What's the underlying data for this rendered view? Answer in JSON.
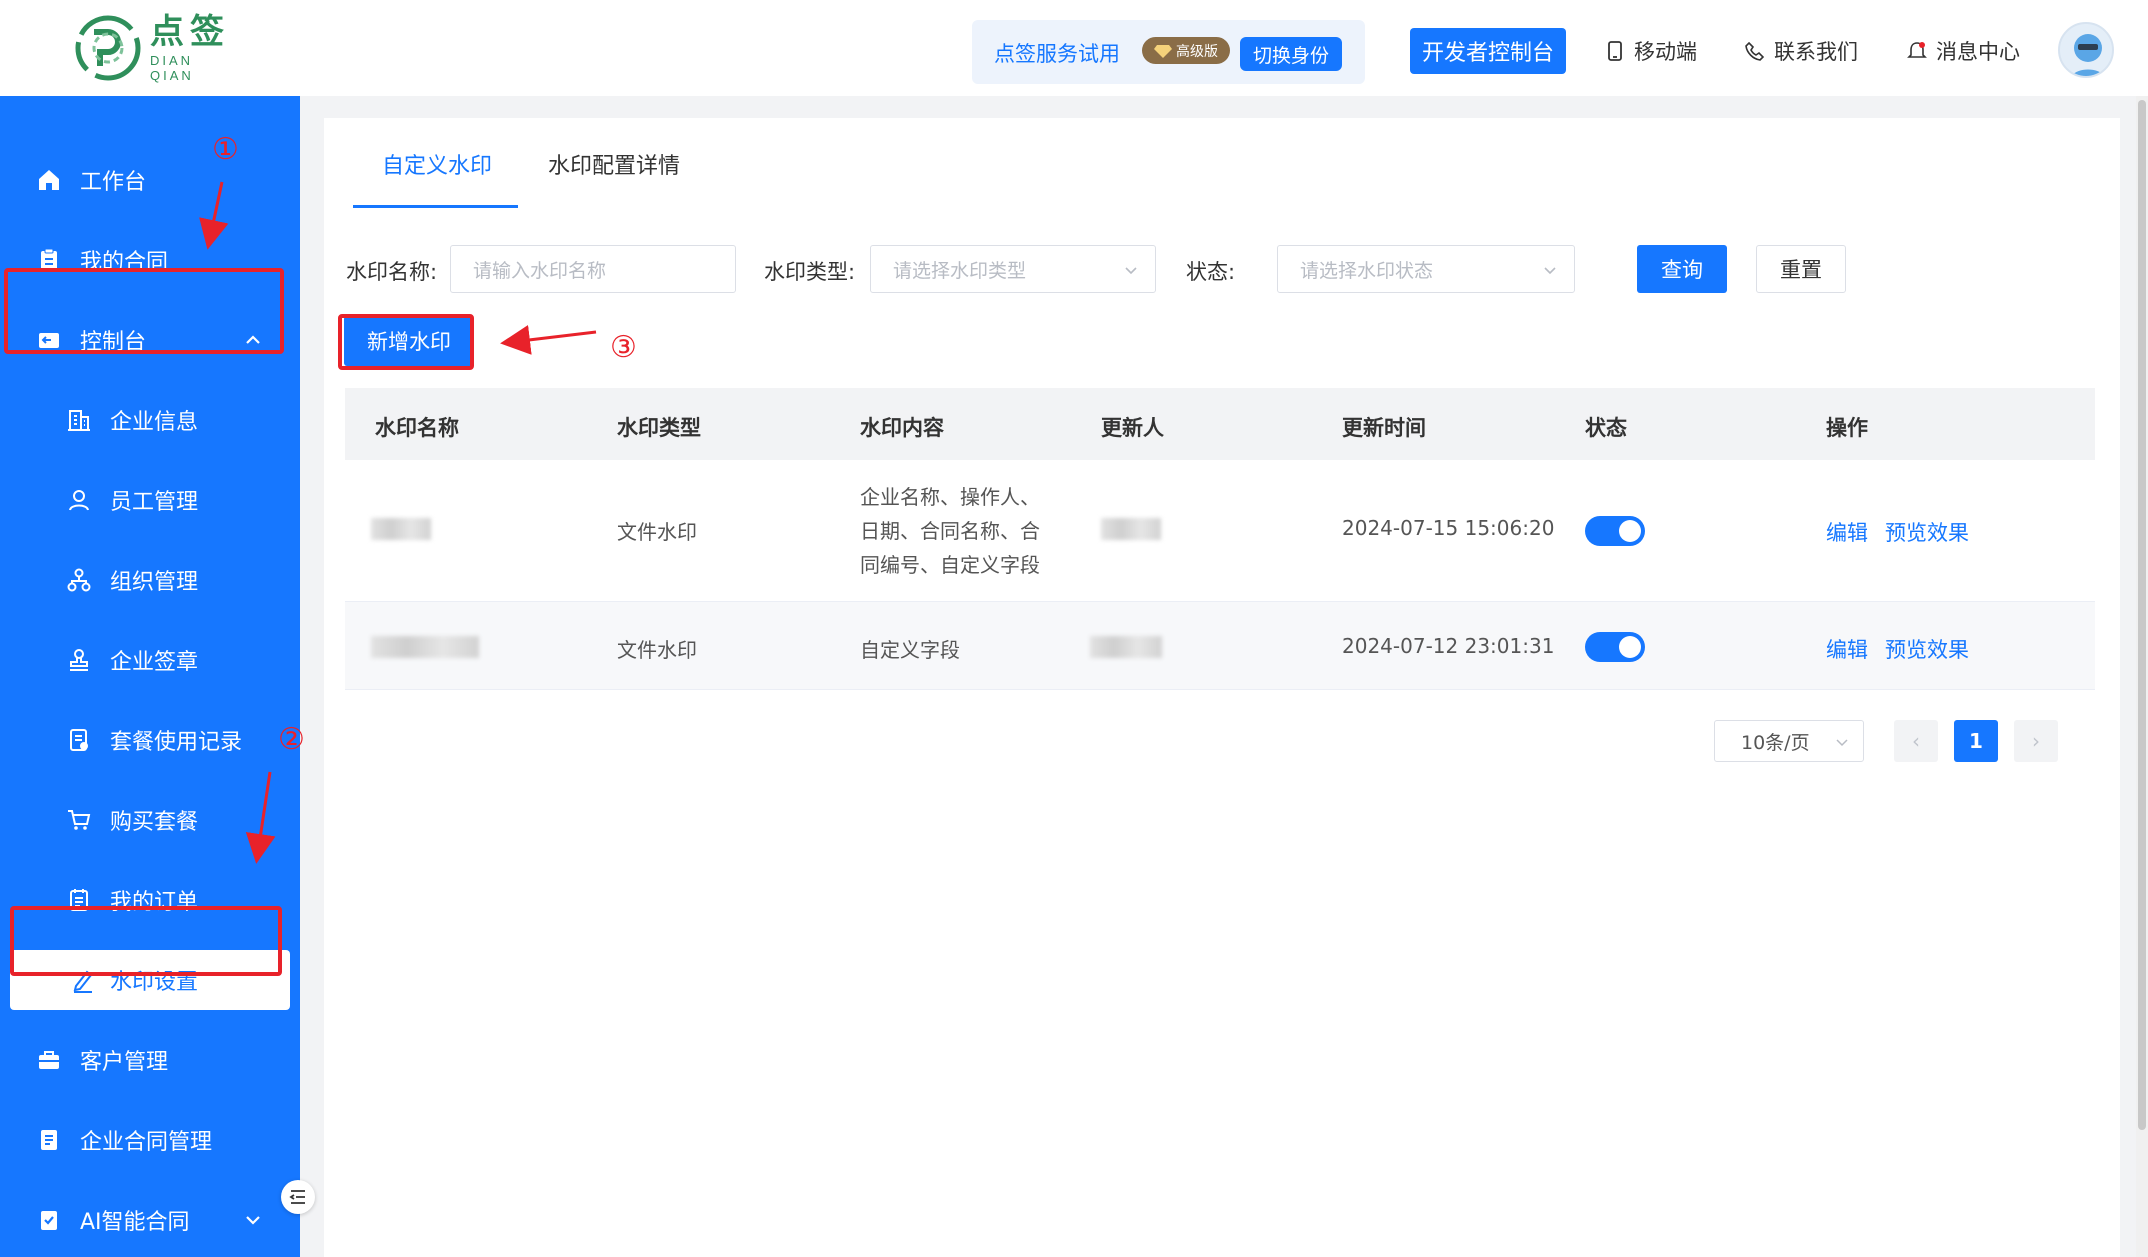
{
  "brand": {
    "name_cn": "点签",
    "name_en": "DIAN QIAN"
  },
  "header": {
    "trial_text": "点签服务试用",
    "badge": "高级版",
    "switch_identity": "切换身份",
    "dev_console": "开发者控制台",
    "mobile": "移动端",
    "contact": "联系我们",
    "messages": "消息中心"
  },
  "sidebar": {
    "items": [
      {
        "label": "工作台",
        "icon": "home-icon"
      },
      {
        "label": "我的合同",
        "icon": "clipboard-icon"
      },
      {
        "label": "控制台",
        "icon": "console-icon"
      },
      {
        "label": "企业信息",
        "icon": "building-icon"
      },
      {
        "label": "员工管理",
        "icon": "user-icon"
      },
      {
        "label": "组织管理",
        "icon": "org-icon"
      },
      {
        "label": "企业签章",
        "icon": "stamp-icon"
      },
      {
        "label": "套餐使用记录",
        "icon": "record-icon"
      },
      {
        "label": "购买套餐",
        "icon": "cart-icon"
      },
      {
        "label": "我的订单",
        "icon": "order-icon"
      },
      {
        "label": "水印设置",
        "icon": "pen-icon"
      },
      {
        "label": "客户管理",
        "icon": "briefcase-icon"
      },
      {
        "label": "企业合同管理",
        "icon": "document-icon"
      },
      {
        "label": "AI智能合同",
        "icon": "check-doc-icon"
      }
    ]
  },
  "tabs": [
    "自定义水印",
    "水印配置详情"
  ],
  "filters": {
    "name_label": "水印名称:",
    "name_placeholder": "请输入水印名称",
    "type_label": "水印类型:",
    "type_placeholder": "请选择水印类型",
    "status_label": "状态:",
    "status_placeholder": "请选择水印状态",
    "query": "查询",
    "reset": "重置"
  },
  "add_button": "新增水印",
  "table": {
    "headers": [
      "水印名称",
      "水印类型",
      "水印内容",
      "更新人",
      "更新时间",
      "状态",
      "操作"
    ],
    "rows": [
      {
        "type": "文件水印",
        "content": [
          "企业名称、操作人、",
          "日期、合同名称、合",
          "同编号、自定义字段"
        ],
        "time": "2024-07-15 15:06:20",
        "enabled": true,
        "edit": "编辑",
        "preview": "预览效果"
      },
      {
        "type": "文件水印",
        "content": [
          "自定义字段"
        ],
        "time": "2024-07-12 23:01:31",
        "enabled": true,
        "edit": "编辑",
        "preview": "预览效果"
      }
    ]
  },
  "pagination": {
    "page_size": "10条/页",
    "current": "1",
    "prev": "‹",
    "next": "›"
  },
  "annotations": {
    "n1": "①",
    "n2": "②",
    "n3": "③"
  },
  "colors": {
    "primary": "#1677ff",
    "annotation": "#e8222a",
    "brand_green": "#2f8f5b"
  }
}
